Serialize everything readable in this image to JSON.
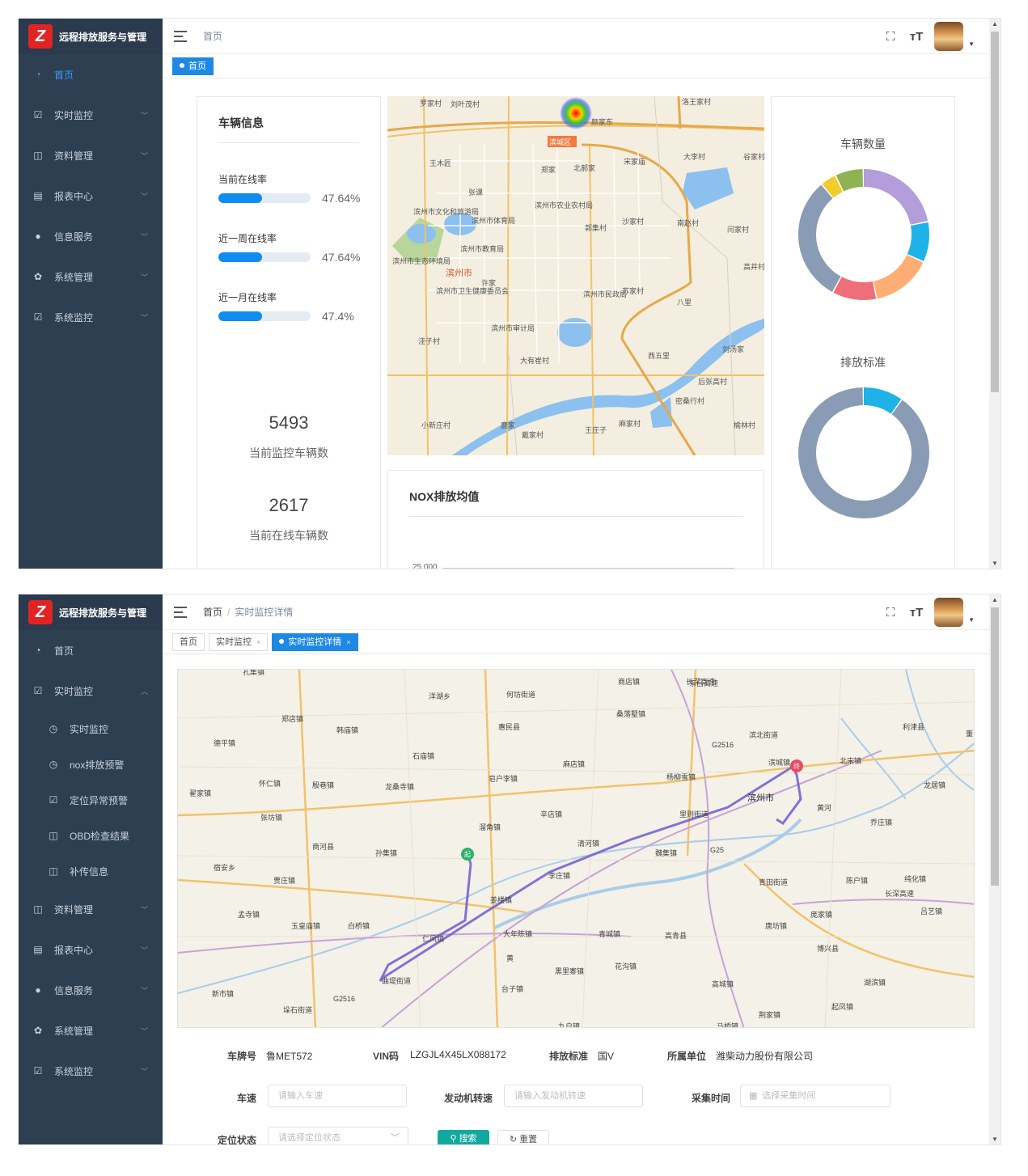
{
  "app": {
    "title": "远程排放服务与管理",
    "logo_letter": "Z"
  },
  "icons": [
    "dashboard-icon",
    "monitor-icon",
    "book-icon",
    "report-icon",
    "globe-icon",
    "gear-icon",
    "fullscreen-icon",
    "font-size-icon"
  ],
  "colors": {
    "sidebar": "#2e3f52",
    "accent": "#1e88e5",
    "bar": "#0f8cf0"
  },
  "screen1": {
    "sidebar": [
      {
        "label": "首页"
      },
      {
        "label": "实时监控"
      },
      {
        "label": "资料管理"
      },
      {
        "label": "报表中心"
      },
      {
        "label": "信息服务"
      },
      {
        "label": "系统管理"
      },
      {
        "label": "系统监控"
      }
    ],
    "breadcrumb": "首页",
    "tabs": [
      {
        "label": "首页"
      }
    ],
    "vehicle_info": {
      "title": "车辆信息",
      "rates": [
        {
          "label": "当前在线率",
          "value": "47.64%",
          "fraction": 0.4764
        },
        {
          "label": "近一周在线率",
          "value": "47.64%",
          "fraction": 0.4764
        },
        {
          "label": "近一月在线率",
          "value": "47.4%",
          "fraction": 0.474
        }
      ],
      "monitored_count": "5493",
      "monitored_caption": "当前监控车辆数",
      "online_count": "2617",
      "online_caption": "当前在线车辆数"
    },
    "map_labels": [
      "罗家村",
      "刘叶茂村",
      "洛王家村",
      "颜家东",
      "滨城区",
      "王木匠",
      "郑家",
      "北郝家",
      "宋家庙",
      "大李村",
      "谷家村",
      "张课",
      "滨州市文化和旅游局",
      "滨州市体育局",
      "滨州市农业农村局",
      "郭集村",
      "沙家村",
      "南赵村",
      "闫家村",
      "滨州市教育局",
      "滨州市生态环境局",
      "滨州市",
      "高井村",
      "许家",
      "滨州市卫生健康委员会",
      "滨州市民政局",
      "苏家村",
      "八里",
      "滨州市审计局",
      "洼子村",
      "大有崔村",
      "西五里",
      "刘汤家",
      "后张高村",
      "密桑行村",
      "鹿家",
      "小新庄村",
      "王庄子",
      "麻家村",
      "戴家村",
      "榆林村"
    ],
    "nox": {
      "title": "NOX排放均值",
      "first_tick": "25,000"
    },
    "donut_vehicles": {
      "title": "车辆数量",
      "segments": [
        {
          "color": "#b39ddb",
          "value": 22
        },
        {
          "color": "#1fb2e8",
          "value": 10
        },
        {
          "color": "#ffad73",
          "value": 15
        },
        {
          "color": "#ee6f7a",
          "value": 11
        },
        {
          "color": "#8a9bb6",
          "value": 31
        },
        {
          "color": "#f2cc2a",
          "value": 4
        },
        {
          "color": "#8fb352",
          "value": 7
        }
      ]
    },
    "donut_standards": {
      "title": "排放标准",
      "segments": [
        {
          "color": "#1fb2e8",
          "value": 10
        },
        {
          "color": "#8a9bb6",
          "value": 90
        }
      ]
    }
  },
  "screen2": {
    "sidebar": [
      {
        "label": "首页"
      },
      {
        "label": "实时监控"
      },
      {
        "label": "实时监控"
      },
      {
        "label": "nox排放预警"
      },
      {
        "label": "定位异常预警"
      },
      {
        "label": "OBD检查结果"
      },
      {
        "label": "补传信息"
      },
      {
        "label": "资料管理"
      },
      {
        "label": "报表中心"
      },
      {
        "label": "信息服务"
      },
      {
        "label": "系统管理"
      },
      {
        "label": "系统监控"
      }
    ],
    "breadcrumb": {
      "home": "首页",
      "sep": "/",
      "current": "实时监控详情"
    },
    "tabs": [
      {
        "label": "首页"
      },
      {
        "label": "实时监控",
        "close": "×"
      },
      {
        "label": "实时监控详情",
        "close": "×"
      }
    ],
    "map_labels": [
      "孔集镇",
      "洋湖乡",
      "何坊街道",
      "商店镇",
      "长深高速",
      "郑店镇",
      "韩庙镇",
      "惠民县",
      "桑落墅镇",
      "德平镇",
      "利津县",
      "董",
      "滨北街道",
      "石庙镇",
      "麻店镇",
      "滨城镇",
      "北宋镇",
      "翟家镇",
      "怀仁镇",
      "殷巷镇",
      "龙桑寺镇",
      "皂户李镇",
      "杨柳雪镇",
      "滨州市",
      "龙居镇",
      "张坊镇",
      "辛店镇",
      "里则街道",
      "黄河",
      "乔庄镇",
      "溜角镇",
      "商河县",
      "清河镇",
      "宿安乡",
      "孙集镇",
      "魏集镇",
      "贾庄镇",
      "李庄镇",
      "青田街道",
      "陈户镇",
      "纯化镇",
      "长深高速",
      "姜楼镇",
      "孟寺镇",
      "玉皇庙镇",
      "白桥镇",
      "吕艺镇",
      "仁风镇",
      "大年陈镇",
      "青城镇",
      "高青县",
      "唐坊镇",
      "庞家镇",
      "博兴县",
      "黄",
      "黑里寨镇",
      "花沟镇",
      "曲堤街道",
      "台子镇",
      "高城镇",
      "湖滨镇",
      "新市镇",
      "垛石街道",
      "九户镇",
      "马桥镇",
      "荆家镇",
      "起凤镇",
      "G2516",
      "G25",
      "G2516",
      "东吕高速"
    ],
    "route": {
      "start": "起",
      "end": "终"
    },
    "vehicle": {
      "plate_label": "车牌号",
      "plate": "鲁MET572",
      "vin_label": "VIN码",
      "vin": "LZGJL4X45LX088172",
      "standard_label": "排放标准",
      "standard": "国V",
      "company_label": "所属单位",
      "company": "潍柴动力股份有限公司"
    },
    "filters": {
      "speed_label": "车速",
      "speed_placeholder": "请输入车速",
      "rpm_label": "发动机转速",
      "rpm_placeholder": "请输入发动机转速",
      "time_label": "采集时间",
      "time_placeholder": "选择采集时间",
      "gps_label": "定位状态",
      "gps_placeholder": "请选择定位状态",
      "search": "搜索",
      "reset": "重置"
    }
  }
}
